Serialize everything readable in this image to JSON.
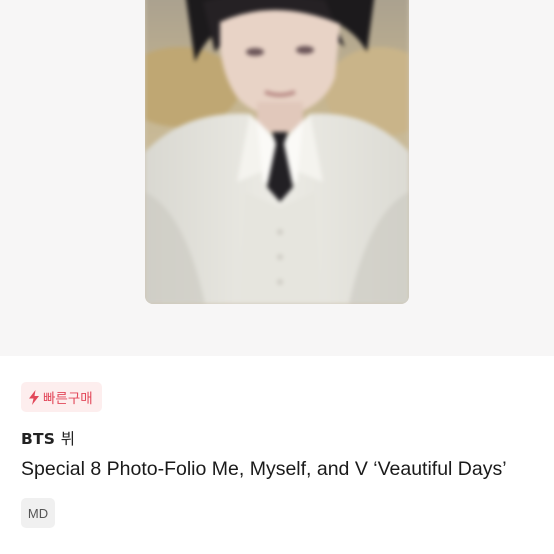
{
  "product": {
    "image_alt": "BTS V photocard",
    "fast_purchase_badge": "빠른구매",
    "artist_group": "BTS",
    "artist_member": "뷔",
    "title": "Special 8 Photo-Folio Me, Myself, and V ‘Veautiful Days’",
    "category_badge": "MD"
  },
  "colors": {
    "badge_fast_bg": "#fdeeee",
    "badge_fast_text": "#e2485a",
    "image_bg": "#f7f6f6"
  },
  "icons": {
    "fast_purchase": "lightning-bolt-icon"
  }
}
